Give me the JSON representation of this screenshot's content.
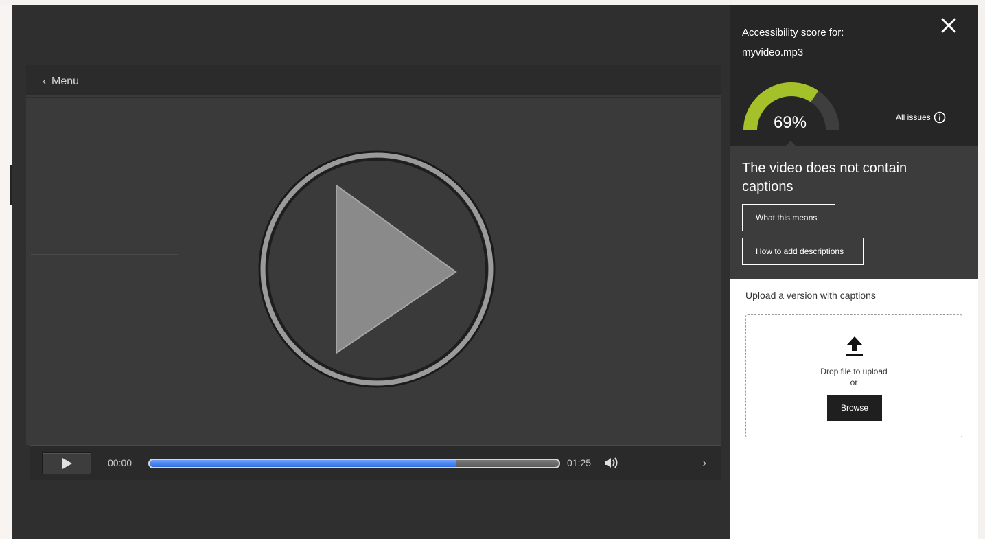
{
  "player": {
    "menu_label": "Menu",
    "time_current": "00:00",
    "time_total": "01:25",
    "progress": 0.75
  },
  "panel": {
    "title_line1": "Accessibility score for:",
    "title_line2": "myvideo.mp3",
    "score_label": "69%",
    "score_value": 0.69,
    "all_issues_label": "All issues",
    "issue_title": "The video does not contain captions",
    "what_this_means_label": "What this means",
    "how_to_add_label": "How to add descriptions",
    "upload_title": "Upload a version with captions",
    "drop_text": "Drop file to upload",
    "or_text": "or",
    "browse_label": "Browse"
  },
  "colors": {
    "gauge_fill": "#a4c12a",
    "gauge_track": "#3e3e3e",
    "progress_fill": "#3f7cf0"
  },
  "icons": [
    "chevron-left-icon",
    "play-icon",
    "volume-icon",
    "chevron-right-icon",
    "close-icon",
    "info-icon",
    "upload-icon"
  ]
}
